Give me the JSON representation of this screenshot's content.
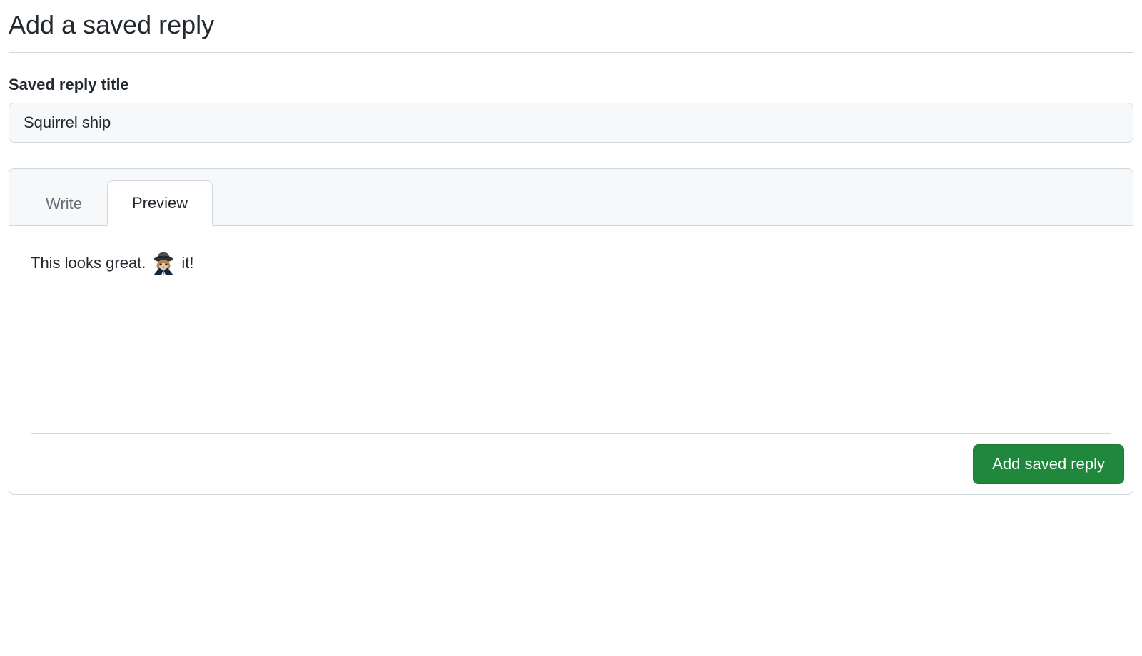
{
  "page": {
    "title": "Add a saved reply"
  },
  "form": {
    "title_label": "Saved reply title",
    "title_value": "Squirrel ship"
  },
  "editor": {
    "tabs": {
      "write": "Write",
      "preview": "Preview",
      "active": "preview"
    },
    "preview_text_before": "This looks great.",
    "preview_emoji": "shipit-squirrel",
    "preview_text_after": "it!"
  },
  "actions": {
    "submit_label": "Add saved reply"
  }
}
